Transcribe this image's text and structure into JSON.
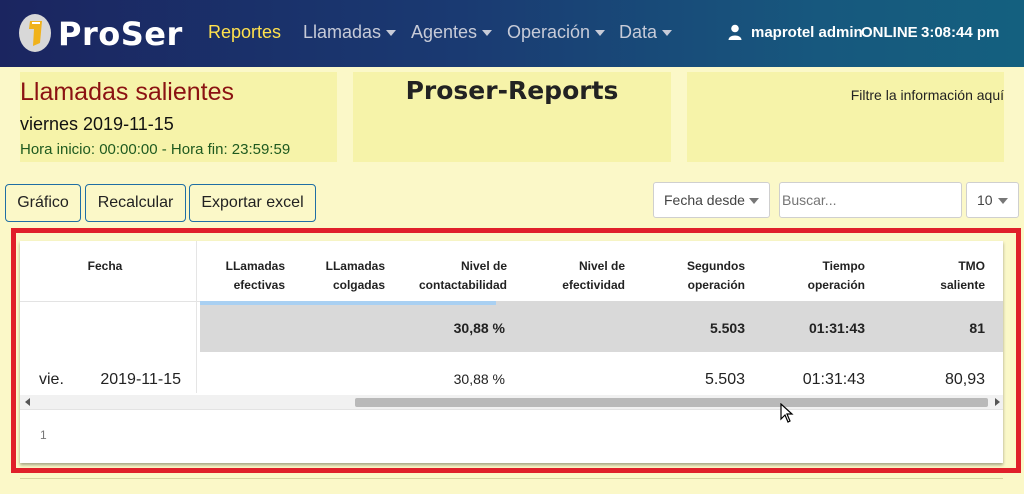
{
  "navbar": {
    "brand": "ProSer",
    "items": [
      {
        "label": "Reportes",
        "active": true,
        "dropdown": false
      },
      {
        "label": "Llamadas",
        "active": false,
        "dropdown": true
      },
      {
        "label": "Agentes",
        "active": false,
        "dropdown": true
      },
      {
        "label": "Operación",
        "active": false,
        "dropdown": true
      },
      {
        "label": "Data",
        "active": false,
        "dropdown": true
      }
    ],
    "user_name": "maprotel admin",
    "status": "ONLINE",
    "time": "3:08:44 pm"
  },
  "report": {
    "title": "Llamadas salientes",
    "date": "viernes 2019-11-15",
    "hours": "Hora inicio: 00:00:00 - Hora fin: 23:59:59",
    "app_title": "Proser-Reports",
    "filter_hint": "Filtre la información aquí"
  },
  "toolbar": {
    "chart_label": "Gráfico",
    "recalc_label": "Recalcular",
    "export_label": "Exportar excel",
    "date_select": "Fecha desde",
    "search_placeholder": "Buscar...",
    "page_size": "10"
  },
  "table": {
    "columns": [
      {
        "l1": "Fecha",
        "l2": ""
      },
      {
        "l1": "LLamadas",
        "l2": "efectivas"
      },
      {
        "l1": "LLamadas",
        "l2": "colgadas"
      },
      {
        "l1": "Nivel de",
        "l2": "contactabilidad"
      },
      {
        "l1": "Nivel de",
        "l2": "efectividad"
      },
      {
        "l1": "Segundos",
        "l2": "operación"
      },
      {
        "l1": "Tiempo",
        "l2": "operación"
      },
      {
        "l1": "TMO",
        "l2": "saliente"
      }
    ],
    "totals": {
      "contactabilidad": "30,88 %",
      "segundos": "5.503",
      "tiempo": "01:31:43",
      "tmo": "81"
    },
    "rows": [
      {
        "day": "vie.",
        "date": "2019-11-15",
        "contactabilidad": "30,88 %",
        "segundos": "5.503",
        "tiempo": "01:31:43",
        "tmo": "80,93"
      }
    ],
    "page": "1"
  },
  "colors": {
    "accent": "#ffe14d",
    "frame": "#e0202a",
    "title_red": "#8b1212",
    "hours_green": "#1f5a1f"
  }
}
